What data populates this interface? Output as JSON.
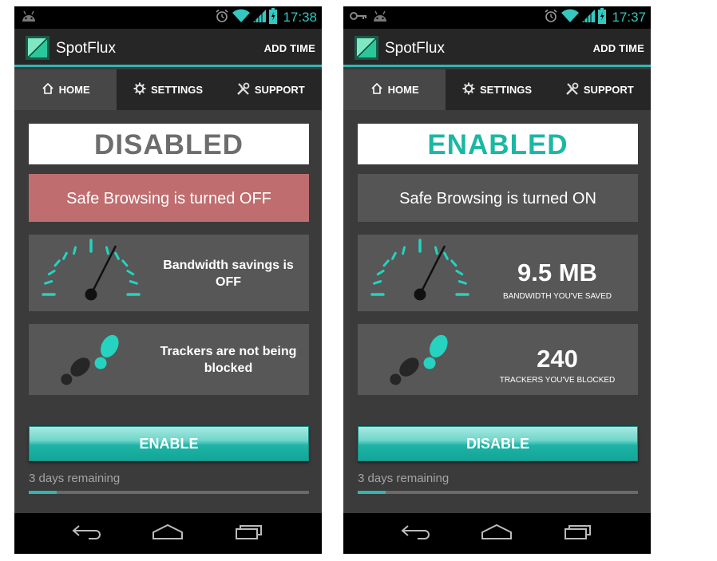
{
  "left": {
    "status": {
      "time": "17:38"
    },
    "header": {
      "app_name": "SpotFlux",
      "add_time": "ADD TIME"
    },
    "tabs": [
      {
        "label": "HOME"
      },
      {
        "label": "SETTINGS"
      },
      {
        "label": "SUPPORT"
      }
    ],
    "state_label": "DISABLED",
    "safe_browsing": "Safe Browsing is turned OFF",
    "bandwidth": {
      "text": "Bandwidth savings is OFF"
    },
    "trackers": {
      "text": "Trackers are not being blocked"
    },
    "button_label": "ENABLE",
    "days_remaining": "3 days remaining",
    "progress_fraction": 0.1
  },
  "right": {
    "status": {
      "time": "17:37"
    },
    "header": {
      "app_name": "SpotFlux",
      "add_time": "ADD TIME"
    },
    "tabs": [
      {
        "label": "HOME"
      },
      {
        "label": "SETTINGS"
      },
      {
        "label": "SUPPORT"
      }
    ],
    "state_label": "ENABLED",
    "safe_browsing": "Safe Browsing is turned ON",
    "bandwidth": {
      "value": "9.5 MB",
      "caption": "BANDWIDTH YOU'VE SAVED"
    },
    "trackers": {
      "value": "240",
      "caption": "TRACKERS YOU'VE BLOCKED"
    },
    "button_label": "DISABLE",
    "days_remaining": "3 days remaining",
    "progress_fraction": 0.1
  },
  "icons": {
    "status_left": [
      "android-icon",
      "key-icon"
    ],
    "status_right": [
      "alarm-icon",
      "wifi-icon",
      "signal-icon",
      "battery-icon"
    ],
    "tabs": [
      "home-icon",
      "gear-icon",
      "tools-icon"
    ],
    "cards": [
      "speedometer-icon",
      "footprints-icon"
    ],
    "nav": [
      "back-icon",
      "home-nav-icon",
      "recent-apps-icon"
    ]
  },
  "colors": {
    "accent": "#33b5b1",
    "enabled_text": "#1ab8a4",
    "disabled_text": "#6d6d6d",
    "safe_off_bg": "#bf6d6e",
    "card_bg": "#575757",
    "screen_bg": "#3b3b3b"
  }
}
